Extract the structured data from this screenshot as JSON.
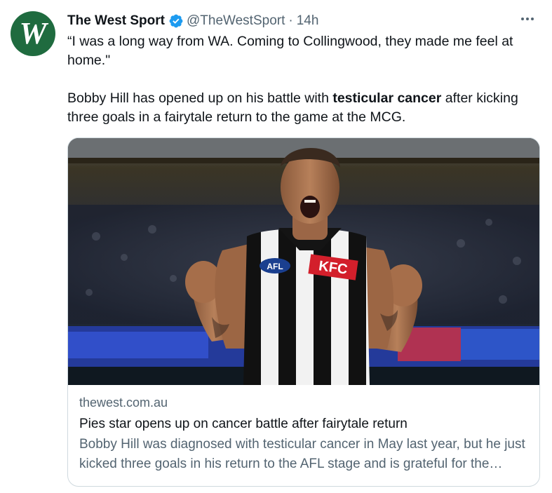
{
  "account": {
    "avatar_text": "W",
    "avatar_color": "#1f6b3f",
    "name": "The West Sport",
    "handle": "@TheWestSport",
    "separator": "·",
    "time": "14h",
    "verified_icon": "verified-badge-icon",
    "verified_color": "#1d9bf0"
  },
  "tweet": {
    "quote_line": "“I was a long way from WA. Coming to Collingwood, they made me feel at home.\"",
    "body_prefix": "Bobby Hill has opened up on his battle with ",
    "body_bold": "testicular cancer",
    "body_suffix": " after kicking three goals in a fairytale return to the game at the MCG."
  },
  "card": {
    "image_alt": "Bobby Hill celebrating in a Collingwood guernsey",
    "jersey_sponsor": "KFC",
    "jersey_logo": "AFL",
    "domain": "thewest.com.au",
    "title": "Pies star opens up on cancer battle after fairytale return",
    "description": "Bobby Hill was diagnosed with testicular cancer in May last year, but he just kicked three goals in his return to the AFL stage and is grateful for the support he received."
  },
  "colors": {
    "text_primary": "#0f1419",
    "text_secondary": "#536471",
    "border": "#cfd9de"
  }
}
